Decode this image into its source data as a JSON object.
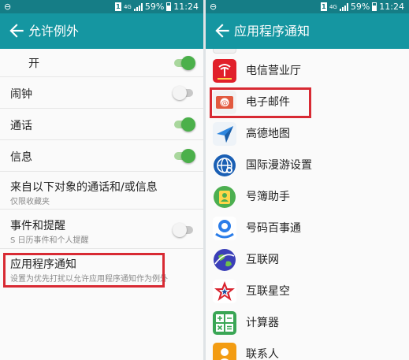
{
  "statusbar": {
    "battery": "59%",
    "time": "11:24",
    "sim": "1",
    "network": "4G"
  },
  "left": {
    "title": "允许例外",
    "rows": [
      {
        "title": "开",
        "toggle": true
      },
      {
        "title": "闹钟",
        "toggle": false
      },
      {
        "title": "通话",
        "toggle": true
      },
      {
        "title": "信息",
        "toggle": true
      },
      {
        "title": "来自以下对象的通话和/或信息",
        "subtitle": "仅限收藏夹"
      },
      {
        "title": "事件和提醒",
        "subtitle": "S 日历事件和个人提醒",
        "toggle": false
      },
      {
        "title": "应用程序通知",
        "subtitle": "设置为优先打扰以允许应用程序通知作为例外"
      }
    ]
  },
  "right": {
    "title": "应用程序通知",
    "apps": [
      {
        "label": "电信营业厅",
        "icon": "telecom-hall-icon"
      },
      {
        "label": "电子邮件",
        "icon": "email-icon"
      },
      {
        "label": "高德地图",
        "icon": "amap-icon"
      },
      {
        "label": "国际漫游设置",
        "icon": "roaming-icon"
      },
      {
        "label": "号簿助手",
        "icon": "contacts-helper-icon"
      },
      {
        "label": "号码百事通",
        "icon": "number-info-icon"
      },
      {
        "label": "互联网",
        "icon": "internet-icon"
      },
      {
        "label": "互联星空",
        "icon": "star-icon"
      },
      {
        "label": "计算器",
        "icon": "calculator-icon"
      },
      {
        "label": "联系人",
        "icon": "contacts-icon"
      }
    ]
  },
  "colors": {
    "status_bar": "#157d86",
    "toolbar": "#1596a1",
    "toggle_on": "#4bb04a",
    "highlight": "#d82a33"
  }
}
